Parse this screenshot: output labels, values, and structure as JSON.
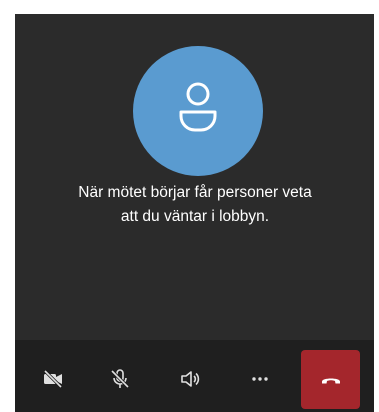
{
  "lobby": {
    "message_line1": "När mötet börjar får personer veta",
    "message_line2": "att du väntar i lobbyn."
  },
  "avatar": {
    "icon": "person-icon",
    "color": "#5a9bd0"
  },
  "controls": {
    "camera_icon": "camera-off-icon",
    "mic_icon": "mic-off-icon",
    "speaker_icon": "speaker-icon",
    "more_icon": "more-icon",
    "hangup_icon": "hang-up-icon",
    "hangup_color": "#a4262c"
  }
}
